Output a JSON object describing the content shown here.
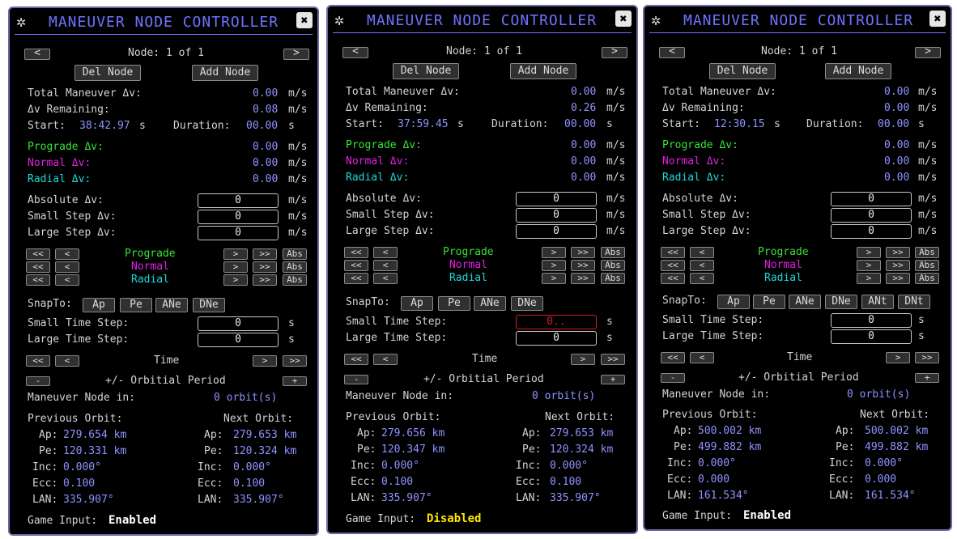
{
  "common": {
    "title": "MANEUVER NODE CONTROLLER",
    "close_glyph": "✖",
    "logo_glyph": "✲",
    "prev_glyph": "<",
    "next_glyph": ">",
    "fast_prev_glyph": "<<",
    "fast_next_glyph": ">>",
    "del_node": "Del Node",
    "add_node": "Add Node",
    "total_label": "Total Maneuver Δv:",
    "remaining_label": "Δv Remaining:",
    "start_label": "Start:",
    "duration_label": "Duration:",
    "unit_ms": "m/s",
    "unit_s": "s",
    "prograde_label": "Prograde Δv:",
    "normal_label": "Normal Δv:",
    "radial_label": "Radial Δv:",
    "absolute_label": "Absolute Δv:",
    "small_step_label": "Small Step Δv:",
    "large_step_label": "Large Step Δv:",
    "prograde": "Prograde",
    "normal": "Normal",
    "radial": "Radial",
    "abs": "Abs",
    "snapto_label": "SnapTo:",
    "small_time_label": "Small Time Step:",
    "large_time_label": "Large Time Step:",
    "time_label": "Time",
    "minus": "-",
    "plus": "+",
    "orbital_period_label": "+/- Orbitial Period",
    "node_in_label": "Maneuver Node in:",
    "prev_orbit_label": "Previous Orbit:",
    "next_orbit_label": "Next Orbit:",
    "ap_label": "Ap:",
    "pe_label": "Pe:",
    "inc_label": "Inc:",
    "ecc_label": "Ecc:",
    "lan_label": "LAN:",
    "game_input_label": "Game Input:"
  },
  "panels": [
    {
      "node": "Node: 1 of 1",
      "total": "0.00",
      "remaining": "0.08",
      "start": "38:42.97",
      "duration": "00.00",
      "prograde": "0.00",
      "normal": "0.00",
      "radial": "0.00",
      "absolute": "0",
      "small_step": "0",
      "large_step": "0",
      "snap": [
        "Ap",
        "Pe",
        "ANe",
        "DNe"
      ],
      "small_time": "0",
      "large_time": "0",
      "node_in": "0 orbit(s)",
      "prev": {
        "ap": "279.654 km",
        "pe": "120.331 km",
        "inc": "0.000°",
        "ecc": "0.100",
        "lan": "335.907°"
      },
      "next": {
        "ap": "279.653 km",
        "pe": "120.324 km",
        "inc": "0.000°",
        "ecc": "0.100",
        "lan": "335.907°"
      },
      "game_input": "Enabled"
    },
    {
      "node": "Node: 1 of 1",
      "total": "0.00",
      "remaining": "0.26",
      "start": "37:59.45",
      "duration": "00.00",
      "prograde": "0.00",
      "normal": "0.00",
      "radial": "0.00",
      "absolute": "0",
      "small_step": "0",
      "large_step": "0",
      "snap": [
        "Ap",
        "Pe",
        "ANe",
        "DNe"
      ],
      "small_time": "0..",
      "large_time": "0",
      "node_in": "0 orbit(s)",
      "prev": {
        "ap": "279.656 km",
        "pe": "120.347 km",
        "inc": "0.000°",
        "ecc": "0.100",
        "lan": "335.907°"
      },
      "next": {
        "ap": "279.653 km",
        "pe": "120.324 km",
        "inc": "0.000°",
        "ecc": "0.100",
        "lan": "335.907°"
      },
      "game_input": "Disabled"
    },
    {
      "node": "Node: 1 of 1",
      "total": "0.00",
      "remaining": "0.00",
      "start": "12:30.15",
      "duration": "00.00",
      "prograde": "0.00",
      "normal": "0.00",
      "radial": "0.00",
      "absolute": "0",
      "small_step": "0",
      "large_step": "0",
      "snap": [
        "Ap",
        "Pe",
        "ANe",
        "DNe",
        "ANt",
        "DNt"
      ],
      "small_time": "0",
      "large_time": "0",
      "node_in": "0 orbit(s)",
      "prev": {
        "ap": "500.002 km",
        "pe": "499.882 km",
        "inc": "0.000°",
        "ecc": "0.000",
        "lan": "161.534°"
      },
      "next": {
        "ap": "500.002 km",
        "pe": "499.882 km",
        "inc": "0.000°",
        "ecc": "0.000",
        "lan": "161.534°"
      },
      "game_input": "Enabled"
    }
  ]
}
